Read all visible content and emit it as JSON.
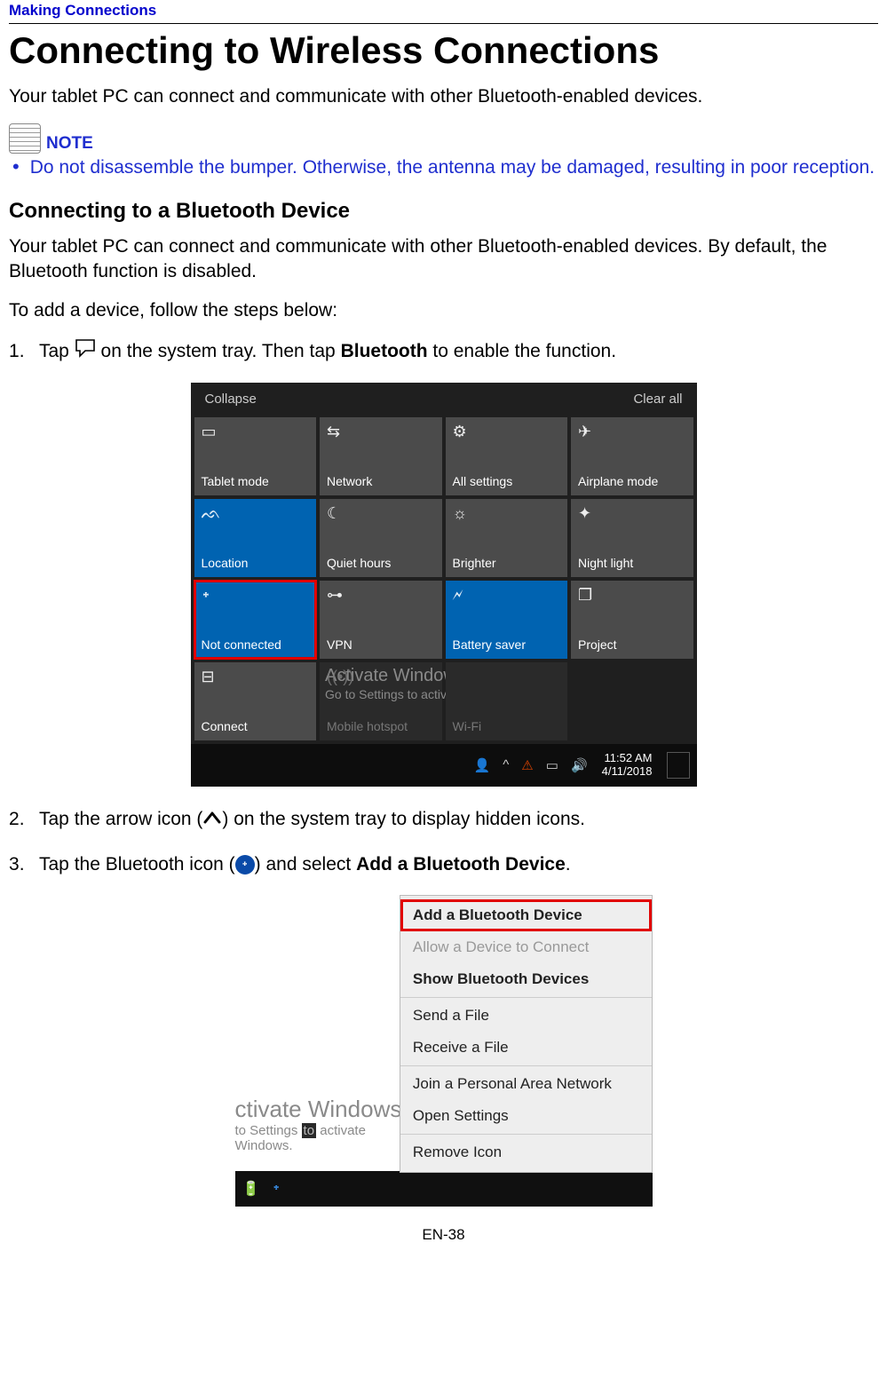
{
  "header": {
    "breadcrumb": "Making Connections"
  },
  "title": "Connecting to Wireless Connections",
  "intro": "Your tablet PC can connect and communicate with other Bluetooth-enabled devices.",
  "note": {
    "label": "NOTE",
    "bullet": "Do not disassemble the bumper. Otherwise, the antenna may be damaged, resulting in poor reception."
  },
  "section": {
    "heading": "Connecting to a Bluetooth Device",
    "p1": "Your tablet PC can connect and communicate with other Bluetooth-enabled devices. By default, the Bluetooth function is disabled.",
    "p2": "To add a device, follow the steps below:"
  },
  "steps": {
    "s1_a": "Tap ",
    "s1_b": " on the system tray. Then tap ",
    "s1_bold": "Bluetooth",
    "s1_c": " to enable the function.",
    "s2_a": "Tap the arrow icon (",
    "s2_b": ") on the system tray to display hidden icons.",
    "s3_a": "Tap the Bluetooth icon (",
    "s3_b": ") and select ",
    "s3_bold": "Add a Bluetooth Device",
    "s3_c": "."
  },
  "action_center": {
    "collapse": "Collapse",
    "clear": "Clear all",
    "tiles": {
      "r1c1": "Tablet mode",
      "r1c2": "Network",
      "r1c3": "All settings",
      "r1c4": "Airplane mode",
      "r2c1": "Location",
      "r2c2": "Quiet hours",
      "r2c3": "Brighter",
      "r2c4": "Night light",
      "r3c1": "Not connected",
      "r3c2": "VPN",
      "r3c3": "Battery saver",
      "r3c4": "Project",
      "r4c1": "Connect",
      "r4c2": "Mobile hotspot",
      "r4c3": "Wi-Fi"
    },
    "watermark1": "Activate Windows",
    "watermark2": "Go to Settings to activate Windows.",
    "taskbar": {
      "time": "11:52 AM",
      "date": "4/11/2018"
    }
  },
  "context_menu": {
    "items": {
      "i1": "Add a Bluetooth Device",
      "i2": "Allow a Device to Connect",
      "i3": "Show Bluetooth Devices",
      "i4": "Send a File",
      "i5": "Receive a File",
      "i6": "Join a Personal Area Network",
      "i7": "Open Settings",
      "i8": "Remove Icon"
    },
    "wm1": "ctivate Windows",
    "wm2_a": " to Settings ",
    "wm2_b": "activate Windows."
  },
  "footer": {
    "page": "EN-38"
  }
}
